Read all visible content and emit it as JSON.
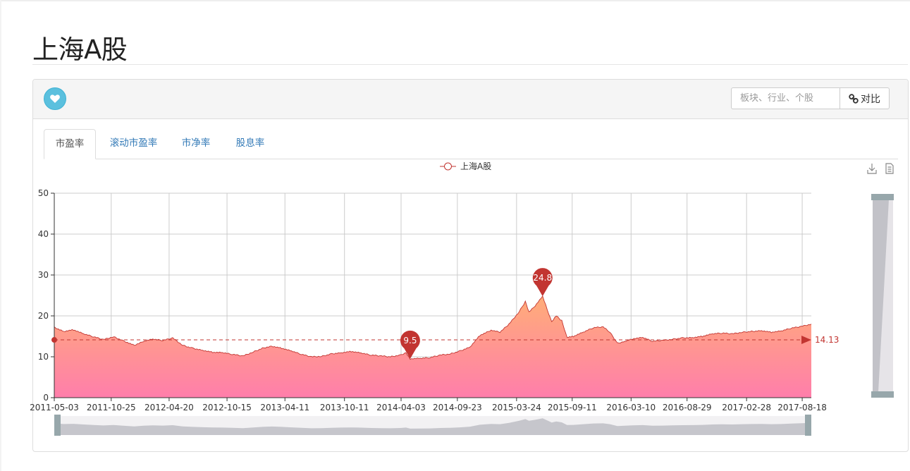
{
  "page": {
    "title": "上海A股"
  },
  "toolbar": {
    "search_placeholder": "板块、行业、个股",
    "compare_label": "对比"
  },
  "tabs": [
    {
      "label": "市盈率",
      "active": true
    },
    {
      "label": "滚动市盈率",
      "active": false
    },
    {
      "label": "市净率",
      "active": false
    },
    {
      "label": "股息率",
      "active": false
    }
  ],
  "chart_data": {
    "type": "area",
    "legend": [
      "上海A股"
    ],
    "ylim": [
      0,
      50
    ],
    "yticks": [
      0,
      10,
      20,
      30,
      40,
      50
    ],
    "x_ticks": [
      "2011-05-03",
      "2011-10-25",
      "2012-04-20",
      "2012-10-15",
      "2013-04-11",
      "2013-10-11",
      "2014-04-03",
      "2014-09-23",
      "2015-03-24",
      "2015-09-11",
      "2016-03-10",
      "2016-08-29",
      "2017-02-28",
      "2017-08-18"
    ],
    "xlim": [
      "2011-05-03",
      "2017-09-15"
    ],
    "series": [
      {
        "name": "上海A股",
        "points": [
          [
            "2011-05-03",
            17.2
          ],
          [
            "2011-06-01",
            16.2
          ],
          [
            "2011-07-01",
            16.6
          ],
          [
            "2011-08-01",
            15.6
          ],
          [
            "2011-09-01",
            14.9
          ],
          [
            "2011-10-01",
            14.2
          ],
          [
            "2011-11-01",
            14.9
          ],
          [
            "2011-12-01",
            13.9
          ],
          [
            "2012-01-04",
            12.8
          ],
          [
            "2012-02-01",
            13.8
          ],
          [
            "2012-03-01",
            14.3
          ],
          [
            "2012-04-01",
            14.0
          ],
          [
            "2012-05-01",
            14.6
          ],
          [
            "2012-06-01",
            12.8
          ],
          [
            "2012-07-01",
            12.1
          ],
          [
            "2012-08-01",
            11.6
          ],
          [
            "2012-09-01",
            11.1
          ],
          [
            "2012-10-01",
            11.0
          ],
          [
            "2012-11-01",
            10.6
          ],
          [
            "2012-12-03",
            10.2
          ],
          [
            "2013-01-04",
            11.2
          ],
          [
            "2013-02-01",
            12.1
          ],
          [
            "2013-03-01",
            12.6
          ],
          [
            "2013-04-01",
            12.1
          ],
          [
            "2013-05-01",
            11.4
          ],
          [
            "2013-06-01",
            10.6
          ],
          [
            "2013-07-01",
            10.0
          ],
          [
            "2013-08-01",
            10.1
          ],
          [
            "2013-09-01",
            10.7
          ],
          [
            "2013-10-01",
            11.0
          ],
          [
            "2013-11-01",
            11.3
          ],
          [
            "2013-12-01",
            10.9
          ],
          [
            "2014-01-02",
            10.4
          ],
          [
            "2014-02-01",
            10.2
          ],
          [
            "2014-03-01",
            10.0
          ],
          [
            "2014-04-01",
            10.4
          ],
          [
            "2014-04-18",
            11.0
          ],
          [
            "2014-05-01",
            9.5
          ],
          [
            "2014-06-01",
            9.6
          ],
          [
            "2014-07-01",
            9.8
          ],
          [
            "2014-08-01",
            10.4
          ],
          [
            "2014-09-01",
            10.7
          ],
          [
            "2014-10-01",
            11.4
          ],
          [
            "2014-11-01",
            12.4
          ],
          [
            "2014-12-01",
            15.2
          ],
          [
            "2015-01-05",
            16.5
          ],
          [
            "2015-02-01",
            16.0
          ],
          [
            "2015-03-01",
            18.0
          ],
          [
            "2015-04-01",
            21.0
          ],
          [
            "2015-04-20",
            23.5
          ],
          [
            "2015-05-01",
            21.0
          ],
          [
            "2015-05-20",
            22.5
          ],
          [
            "2015-06-12",
            24.8
          ],
          [
            "2015-07-01",
            20.5
          ],
          [
            "2015-07-10",
            18.5
          ],
          [
            "2015-07-24",
            20.0
          ],
          [
            "2015-08-10",
            18.8
          ],
          [
            "2015-08-26",
            14.8
          ],
          [
            "2015-09-15",
            15.0
          ],
          [
            "2015-10-15",
            16.0
          ],
          [
            "2015-11-15",
            17.1
          ],
          [
            "2015-12-15",
            17.3
          ],
          [
            "2016-01-05",
            16.0
          ],
          [
            "2016-01-28",
            13.3
          ],
          [
            "2016-02-20",
            13.8
          ],
          [
            "2016-03-15",
            14.4
          ],
          [
            "2016-04-15",
            14.7
          ],
          [
            "2016-05-15",
            13.8
          ],
          [
            "2016-06-15",
            14.0
          ],
          [
            "2016-07-15",
            14.3
          ],
          [
            "2016-08-15",
            14.6
          ],
          [
            "2016-09-15",
            14.7
          ],
          [
            "2016-10-15",
            15.0
          ],
          [
            "2016-11-15",
            15.6
          ],
          [
            "2016-12-15",
            15.8
          ],
          [
            "2017-01-15",
            15.6
          ],
          [
            "2017-02-15",
            16.0
          ],
          [
            "2017-03-15",
            16.2
          ],
          [
            "2017-04-15",
            16.4
          ],
          [
            "2017-05-15",
            16.0
          ],
          [
            "2017-06-15",
            16.3
          ],
          [
            "2017-07-15",
            17.0
          ],
          [
            "2017-08-15",
            17.4
          ],
          [
            "2017-09-15",
            18.0
          ]
        ]
      }
    ],
    "mark_points": [
      {
        "label": "9.5",
        "date": "2014-05-01",
        "value": 9.5,
        "type": "min"
      },
      {
        "label": "24.8",
        "date": "2015-06-12",
        "value": 24.8,
        "type": "max"
      }
    ],
    "mark_line": {
      "label": "14.13",
      "value": 14.13,
      "type": "average"
    },
    "grid": true,
    "legend_position": "top-center",
    "colors": {
      "line": "#c23531",
      "area_top": "#ffab7a",
      "area_bottom": "#ff7eaa",
      "marker": "#c23531",
      "zoom": "#97a7ab"
    }
  }
}
